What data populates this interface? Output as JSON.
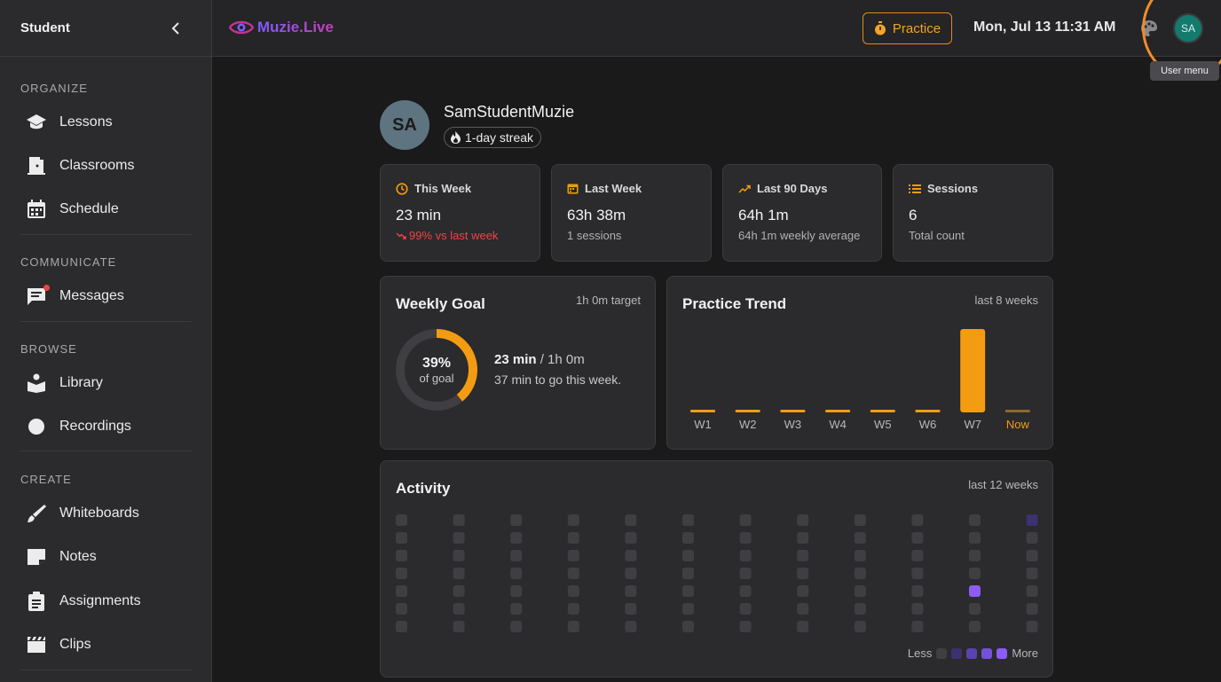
{
  "sidebar": {
    "title": "Student",
    "sections": [
      {
        "label": "ORGANIZE",
        "items": [
          {
            "label": "Lessons",
            "icon": "lessons-icon"
          },
          {
            "label": "Classrooms",
            "icon": "classrooms-icon"
          },
          {
            "label": "Schedule",
            "icon": "calendar-icon"
          }
        ]
      },
      {
        "label": "COMMUNICATE",
        "items": [
          {
            "label": "Messages",
            "icon": "messages-icon",
            "badge": true
          }
        ]
      },
      {
        "label": "BROWSE",
        "items": [
          {
            "label": "Library",
            "icon": "library-icon"
          },
          {
            "label": "Recordings",
            "icon": "record-icon"
          }
        ]
      },
      {
        "label": "CREATE",
        "items": [
          {
            "label": "Whiteboards",
            "icon": "brush-icon"
          },
          {
            "label": "Notes",
            "icon": "notes-icon"
          },
          {
            "label": "Assignments",
            "icon": "clipboard-icon"
          },
          {
            "label": "Clips",
            "icon": "clapper-icon"
          }
        ]
      }
    ]
  },
  "topbar": {
    "brand": "Muzie.Live",
    "practice_label": "Practice",
    "datetime": "Mon, Jul 13 11:31 AM",
    "avatar_initials": "SA",
    "tooltip": "User menu"
  },
  "profile": {
    "initials": "SA",
    "name": "SamStudentMuzie",
    "streak": "1-day streak"
  },
  "stats": [
    {
      "title": "This Week",
      "value": "23 min",
      "sub": "99% vs last week",
      "icon": "clock-icon",
      "trend": "down"
    },
    {
      "title": "Last Week",
      "value": "63h 38m",
      "sub": "1 sessions",
      "icon": "calendar-icon"
    },
    {
      "title": "Last 90 Days",
      "value": "64h 1m",
      "sub": "64h 1m weekly average",
      "icon": "trend-up-icon"
    },
    {
      "title": "Sessions",
      "value": "6",
      "sub": "Total count",
      "icon": "list-icon"
    }
  ],
  "weekly_goal": {
    "title": "Weekly Goal",
    "target": "1h 0m target",
    "percent_label": "39%",
    "percent": 0.39,
    "of_goal": "of goal",
    "done": "23 min",
    "total": " / 1h 0m",
    "remaining": "37 min to go this week."
  },
  "trend": {
    "title": "Practice Trend",
    "range": "last 8 weeks"
  },
  "activity": {
    "title": "Activity",
    "range": "last 12 weeks",
    "less": "Less",
    "more": "More",
    "weeks": 12,
    "days": 7,
    "cells": [
      {
        "week": 11,
        "day": 0,
        "level": 1
      },
      {
        "week": 10,
        "day": 4,
        "level": 4
      }
    ],
    "colors": [
      "#3f3e42",
      "#3b3270",
      "#5a43b0",
      "#7452d6",
      "#8b5cf6"
    ]
  },
  "colors": {
    "accent": "#f39c12",
    "purple": "#8b5cf6"
  },
  "chart_data": {
    "type": "bar",
    "categories": [
      "W1",
      "W2",
      "W3",
      "W4",
      "W5",
      "W6",
      "W7",
      "Now"
    ],
    "values": [
      0,
      0,
      0,
      0,
      0,
      0,
      63.6,
      0.38
    ],
    "ylim": [
      0,
      63.6
    ]
  }
}
